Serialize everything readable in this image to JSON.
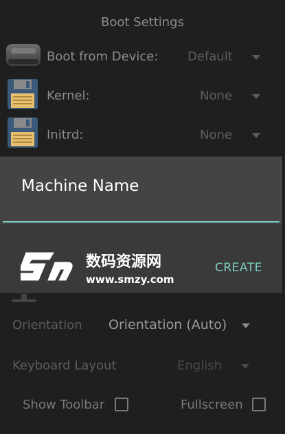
{
  "header": {
    "title": "Boot Settings"
  },
  "boot_settings": {
    "rows": [
      {
        "label": "Boot from Device:",
        "value": "Default",
        "icon": "hard-drive-icon"
      },
      {
        "label": "Kernel:",
        "value": "None",
        "icon": "floppy-disk-icon"
      },
      {
        "label": "Initrd:",
        "value": "None",
        "icon": "floppy-disk-icon"
      }
    ]
  },
  "dialog": {
    "title": "Machine Name",
    "action_label": "CREATE"
  },
  "watermark": {
    "brand_cn": "数码资源网",
    "url": "www.smzy.com"
  },
  "display": {
    "orientation_label": "Orientation",
    "orientation_value": "Orientation (Auto)",
    "keyboard_label": "Keyboard Layout",
    "keyboard_value": "English",
    "show_toolbar_label": "Show Toolbar",
    "fullscreen_label": "Fullscreen"
  },
  "colors": {
    "accent": "#7bd1c4",
    "dialog_bg": "#3a3a3a",
    "background": "#1f1f1f"
  }
}
